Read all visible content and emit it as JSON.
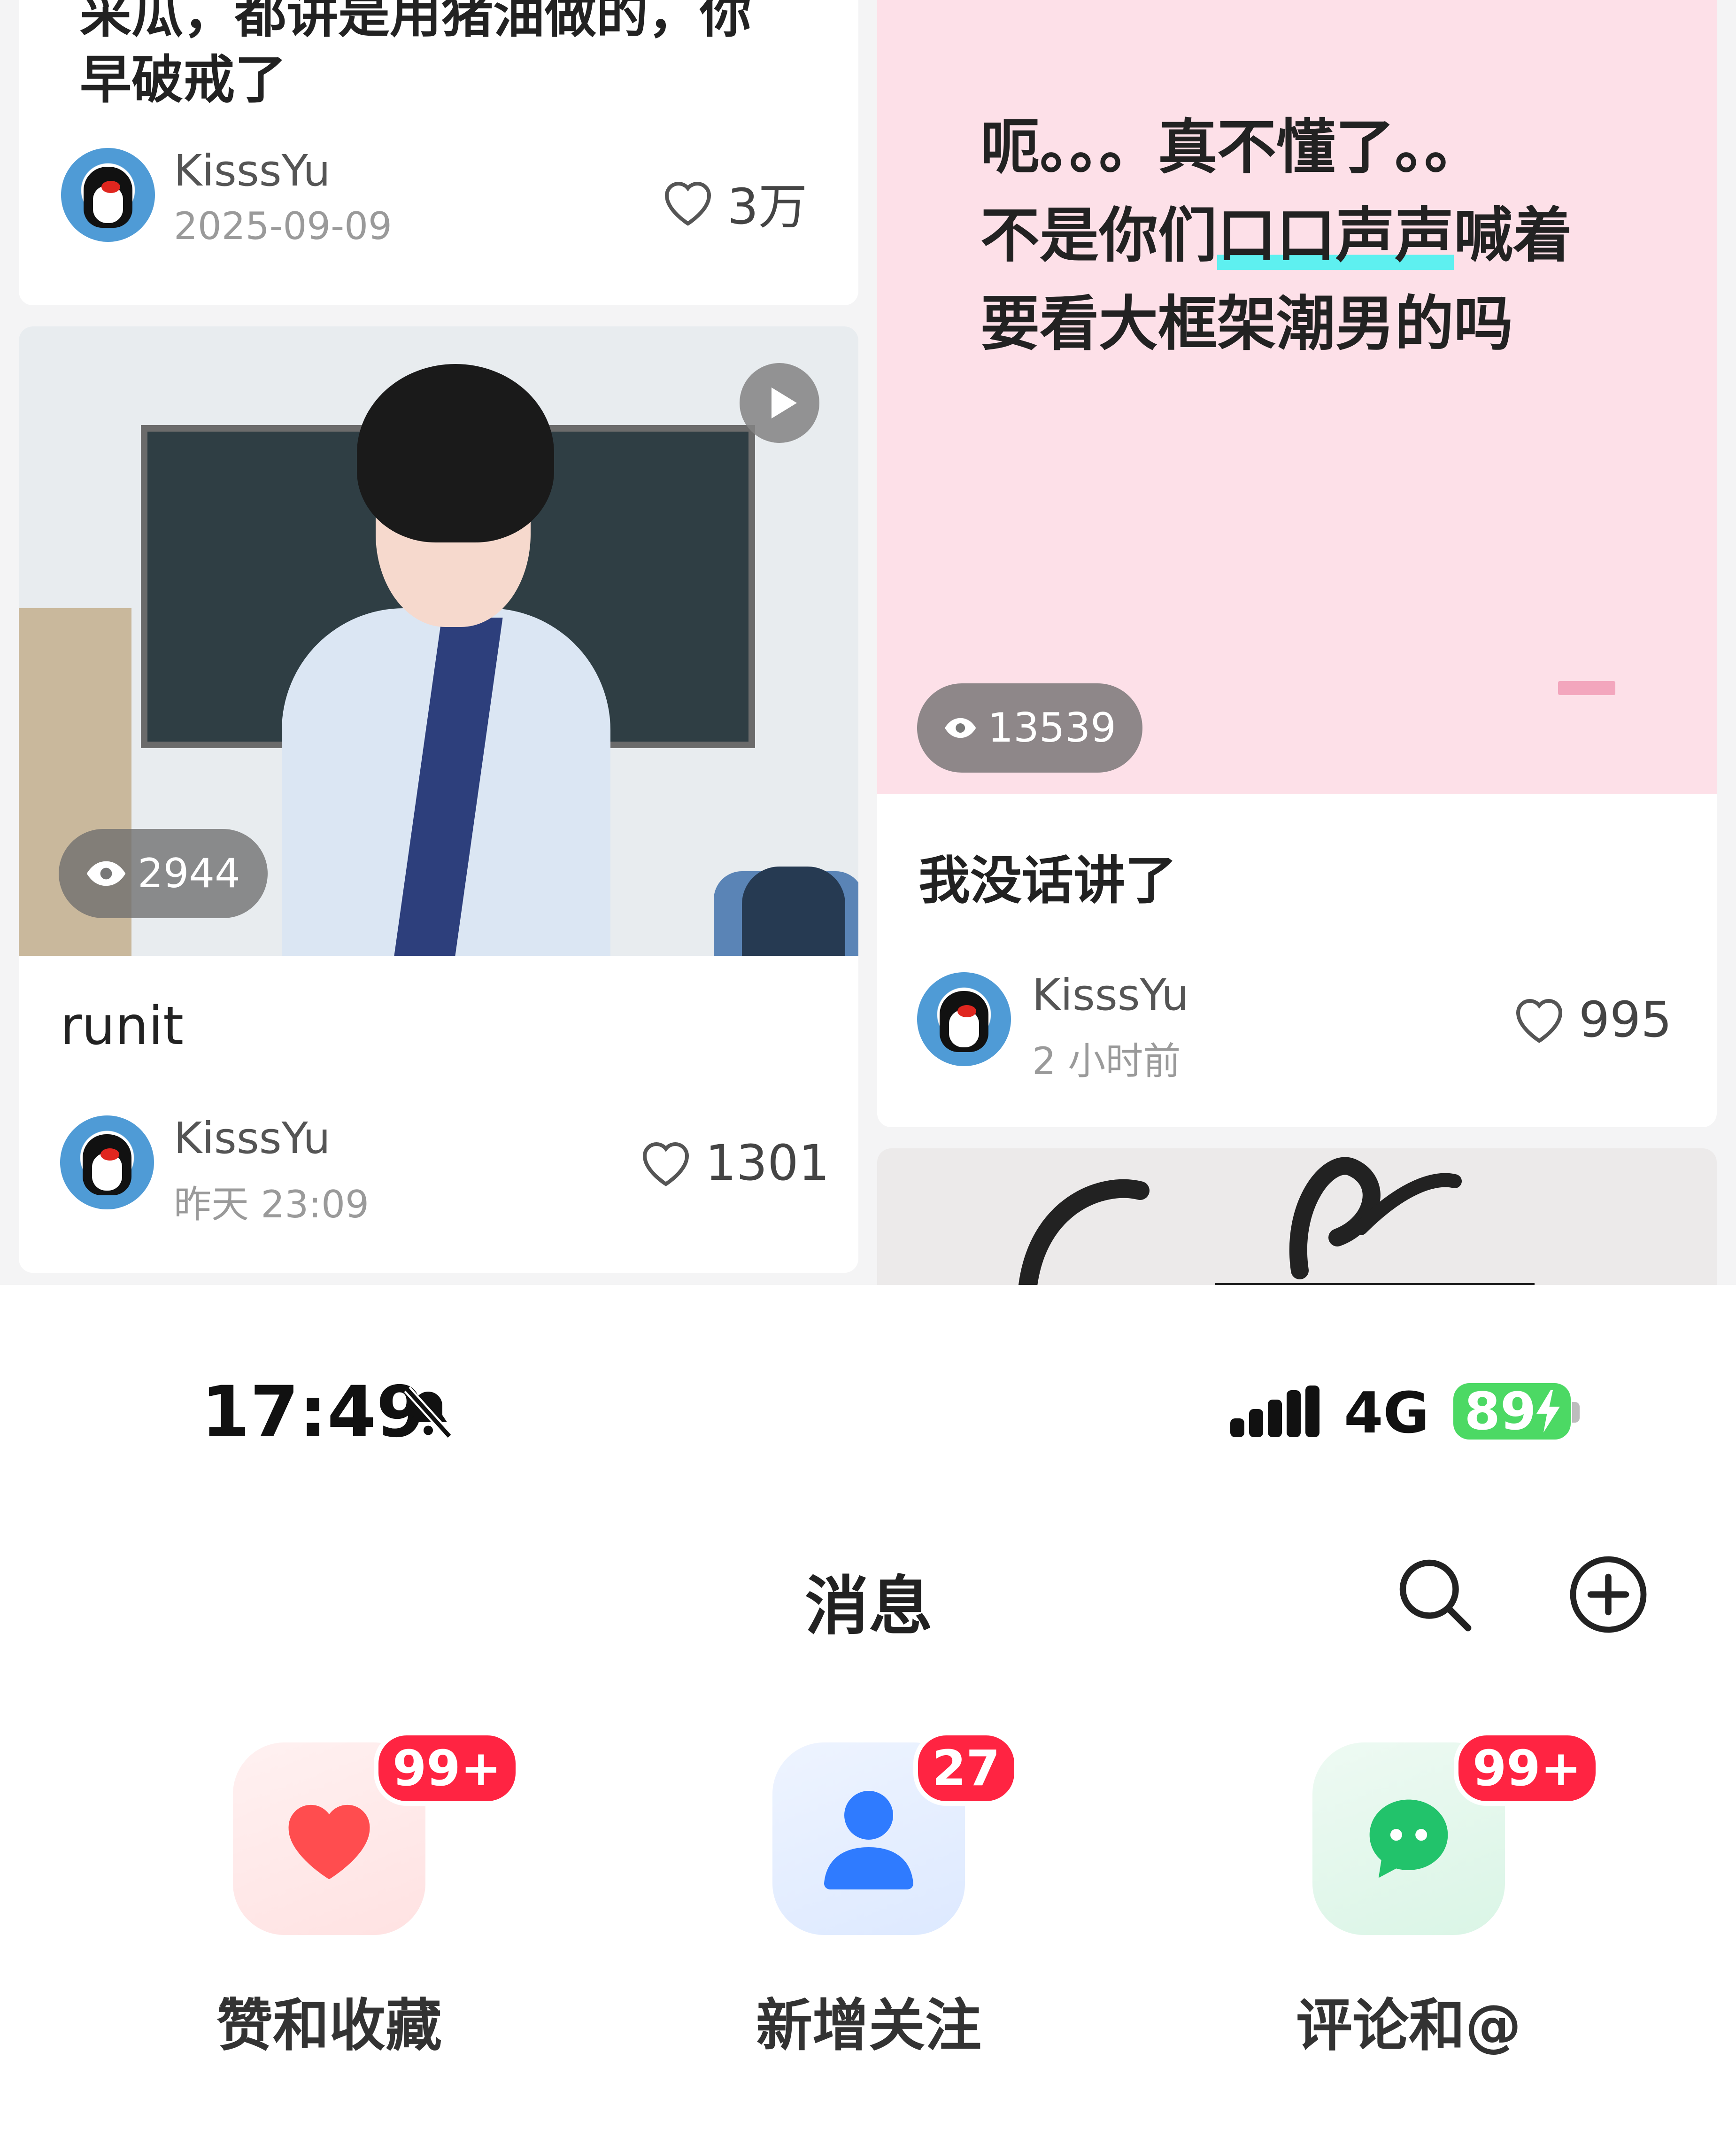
{
  "feed": {
    "left_col": {
      "top_card": {
        "cutoff_text": "采瓜，都讲是用猪油做的，你",
        "snippet": "早破戒了",
        "author": "KisssYu",
        "date": "2025-09-09",
        "likes": "3万"
      },
      "video_card": {
        "views": "2944",
        "title": "runit",
        "author": "KisssYu",
        "date": "昨天 23:09",
        "likes": "1301"
      }
    },
    "right_col": {
      "text_card": {
        "line1": "呃。。。真不懂了。。",
        "line2_pre": "不是你们",
        "line2_hl": "口口声声",
        "line2_post": "喊着",
        "line3": "要看大框架潮男的吗",
        "views": "13539",
        "title": "我没话讲了",
        "author": "KisssYu",
        "date": "2 小时前",
        "likes": "995"
      }
    }
  },
  "status_bar": {
    "time": "17:49",
    "network": "4G",
    "battery": "89"
  },
  "header": {
    "title": "消息"
  },
  "tiles": [
    {
      "label": "赞和收藏",
      "badge": "99+",
      "icon": "heart-icon",
      "color": "#ff4d4f"
    },
    {
      "label": "新增关注",
      "badge": "27",
      "icon": "person-icon",
      "color": "#2f7bff"
    },
    {
      "label": "评论和@",
      "badge": "99+",
      "icon": "chat-bubble-icon",
      "color": "#22c36b"
    }
  ]
}
